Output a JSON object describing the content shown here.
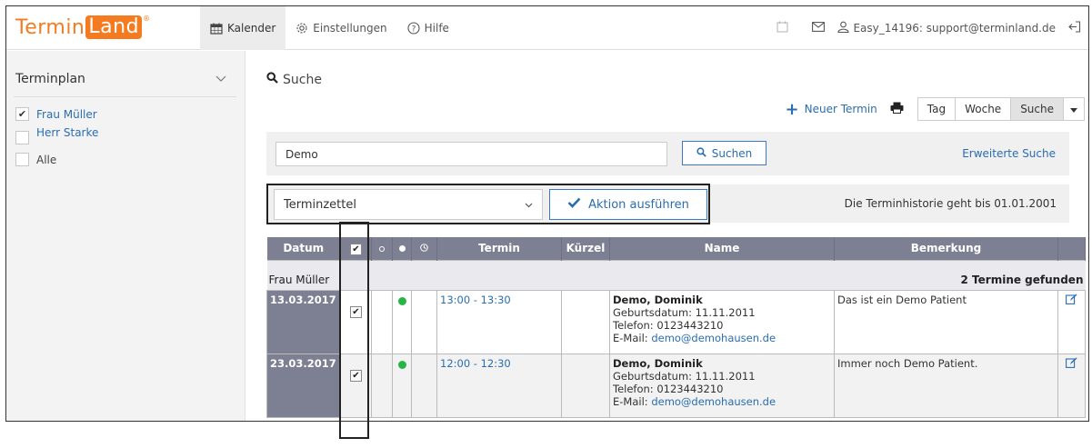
{
  "brand": {
    "logo_part1": "Termin",
    "logo_part2": "Land",
    "logo_mark": "®",
    "accent": "#f47b20"
  },
  "nav": {
    "items": [
      {
        "label": "Kalender",
        "icon": "calendar-icon",
        "active": true
      },
      {
        "label": "Einstellungen",
        "icon": "gear-icon",
        "active": false
      },
      {
        "label": "Hilfe",
        "icon": "help-icon",
        "active": false
      }
    ],
    "user": "Easy_14196: support@terminland.de"
  },
  "sidebar": {
    "title": "Terminplan",
    "items": [
      {
        "label": "Frau Müller",
        "checked": true
      },
      {
        "label": "Herr Starke",
        "checked": false
      },
      {
        "label": "Alle",
        "checked": false
      }
    ]
  },
  "main": {
    "title": "Suche",
    "new_appointment": "Neuer Termin",
    "views": [
      "Tag",
      "Woche",
      "Suche"
    ],
    "search_value": "Demo",
    "search_button": "Suchen",
    "advanced_search": "Erweiterte Suche",
    "action_select": "Terminzettel",
    "action_button": "Aktion ausführen",
    "history_note": "Die Terminhistorie geht bis 01.01.2001"
  },
  "table": {
    "headers": {
      "date": "Datum",
      "time": "Termin",
      "short": "Kürzel",
      "name": "Name",
      "remark": "Bemerkung"
    },
    "group": {
      "name": "Frau Müller",
      "found": "2 Termine gefunden"
    },
    "rows": [
      {
        "date": "13.03.2017",
        "time": "13:00 - 13:30",
        "patient": "Demo, Dominik",
        "birth": "Geburtsdatum: 11.11.2011",
        "phone": "Telefon: 0123443210",
        "email_label": "E-Mail:",
        "email": "demo@demohausen.de",
        "remark": "Das ist ein Demo Patient"
      },
      {
        "date": "23.03.2017",
        "time": "12:00 - 12:30",
        "patient": "Demo, Dominik",
        "birth": "Geburtsdatum: 11.11.2011",
        "phone": "Telefon: 0123443210",
        "email_label": "E-Mail:",
        "email": "demo@demohausen.de",
        "remark": "Immer noch Demo Patient."
      }
    ]
  }
}
